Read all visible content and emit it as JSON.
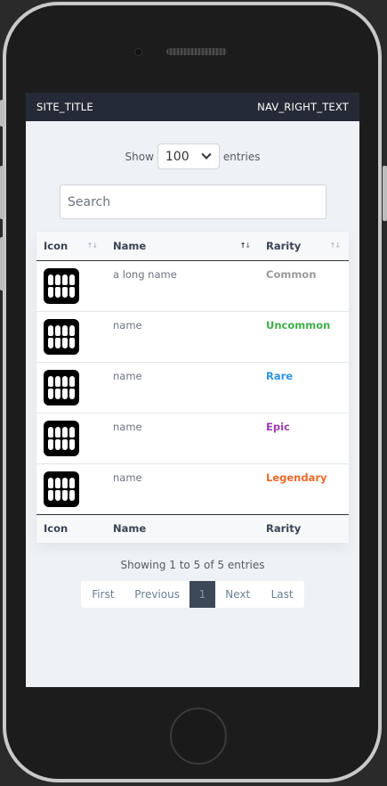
{
  "navbar": {
    "title": "SITE_TITLE",
    "right": "NAV_RIGHT_TEXT"
  },
  "length": {
    "show": "Show",
    "value": "100",
    "entries": "entries"
  },
  "search": {
    "placeholder": "Search"
  },
  "table": {
    "columns": [
      "Icon",
      "Name",
      "Rarity"
    ],
    "rows": [
      {
        "name": "a long name",
        "rarity": "Common",
        "color": "#9a9a9a"
      },
      {
        "name": "name",
        "rarity": "Uncommon",
        "color": "#3fae49"
      },
      {
        "name": "name",
        "rarity": "Rare",
        "color": "#2f93e0"
      },
      {
        "name": "name",
        "rarity": "Epic",
        "color": "#9c3fb0"
      },
      {
        "name": "name",
        "rarity": "Legendary",
        "color": "#ee6a2a"
      }
    ]
  },
  "info": "Showing 1 to 5 of 5 entries",
  "pager": {
    "first": "First",
    "previous": "Previous",
    "current": "1",
    "next": "Next",
    "last": "Last"
  }
}
